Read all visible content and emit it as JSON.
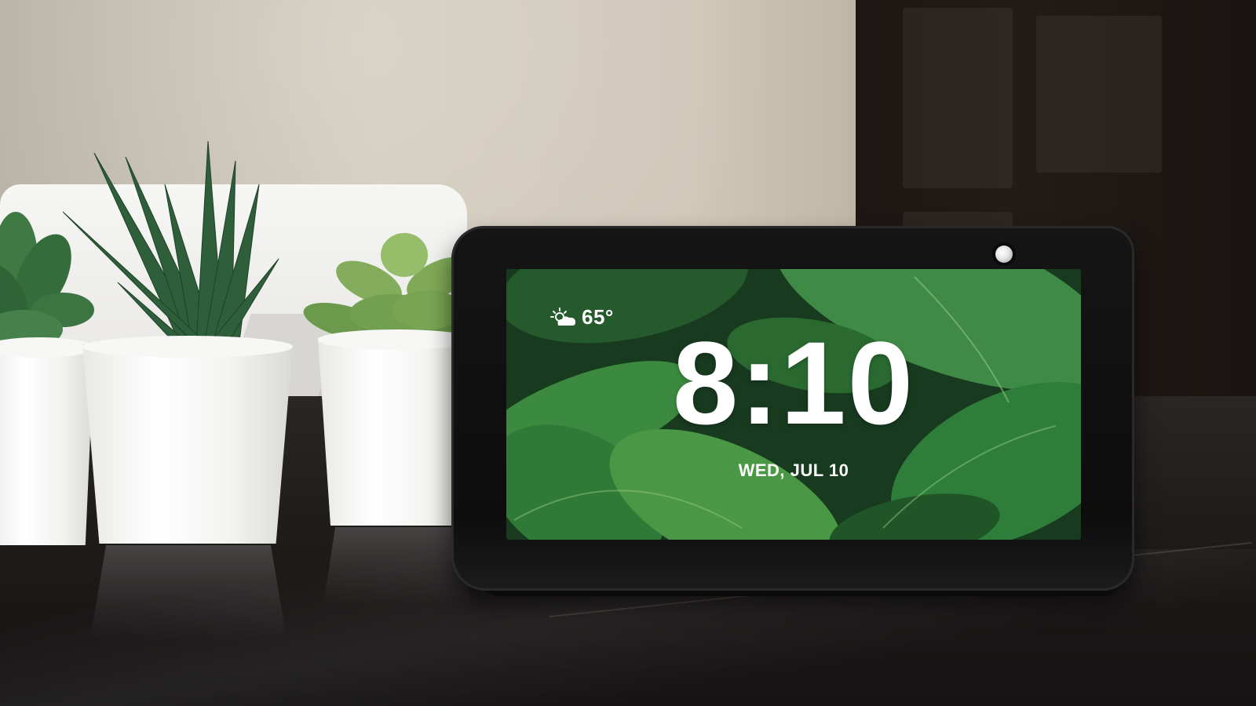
{
  "device_screen": {
    "weather_icon": "partly-cloudy-icon",
    "temperature": "65°",
    "time": "8:10",
    "date": "WED, JUL 10"
  },
  "colors": {
    "screen_text": "#ffffff",
    "leaf_green": "#2f7a3a",
    "device_body": "#111111"
  }
}
